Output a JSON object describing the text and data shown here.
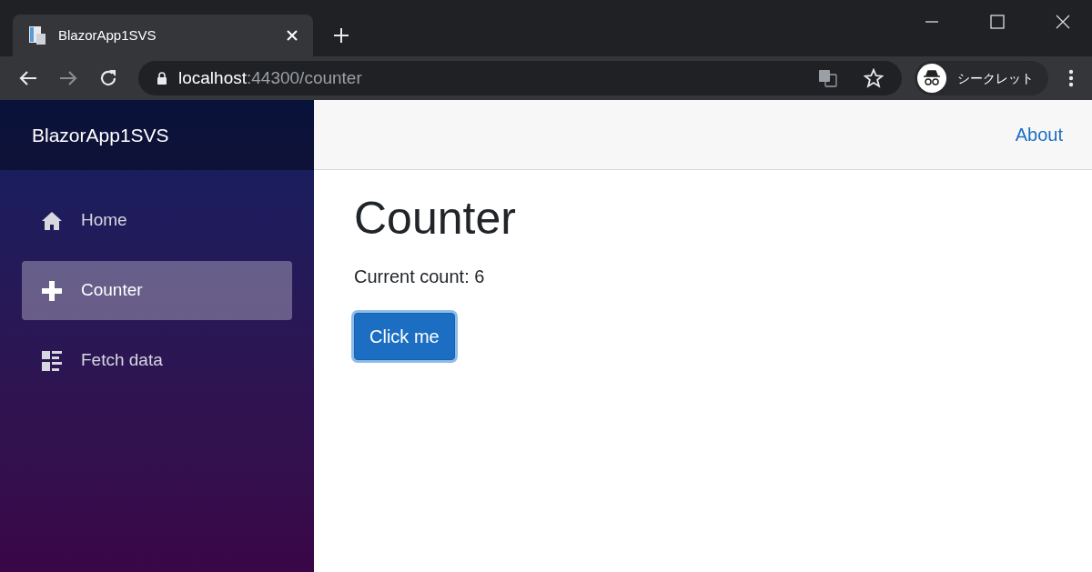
{
  "browser": {
    "tab": {
      "title": "BlazorApp1SVS",
      "selected": true
    },
    "address": {
      "host": "localhost",
      "path": ":44300/counter"
    },
    "profile": "シークレット"
  },
  "sidebar": {
    "brand": "BlazorApp1SVS",
    "items": [
      {
        "kind": "home",
        "label": "Home",
        "selected": false
      },
      {
        "kind": "plus",
        "label": "Counter",
        "selected": true
      },
      {
        "kind": "list",
        "label": "Fetch data",
        "selected": false
      }
    ]
  },
  "top_bar": {
    "link": "About"
  },
  "main": {
    "heading": "Counter",
    "text": "Current count: 6",
    "button": "Click me"
  }
}
